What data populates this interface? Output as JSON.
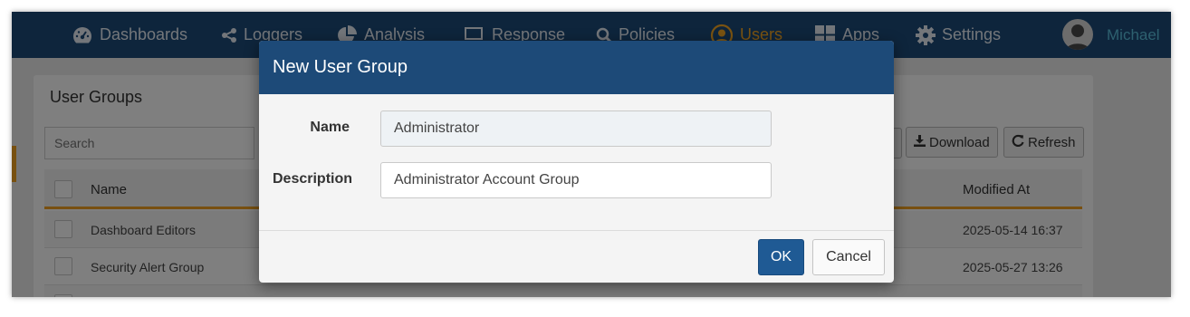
{
  "nav": {
    "items": [
      {
        "label": "Dashboards",
        "icon": "dashboard-gauge-icon"
      },
      {
        "label": "Loggers",
        "icon": "share-nodes-icon"
      },
      {
        "label": "Analysis",
        "icon": "pie-chart-icon"
      },
      {
        "label": "Response",
        "icon": "laptop-icon"
      },
      {
        "label": "Policies",
        "icon": "search-icon"
      },
      {
        "label": "Users",
        "icon": "user-circle-icon",
        "active": true
      },
      {
        "label": "Apps",
        "icon": "grid-icon"
      },
      {
        "label": "Settings",
        "icon": "gear-icon"
      }
    ],
    "user_name": "Michael",
    "active_color": "#f5a623",
    "bar_color": "#1d4a78"
  },
  "page": {
    "title": "User Groups",
    "search_placeholder": "Search",
    "download_label": "Download",
    "refresh_label": "Refresh",
    "columns": {
      "name": "Name",
      "modified": "Modified At"
    },
    "rows": [
      {
        "name": "Dashboard Editors",
        "modified": "2025-05-14 16:37"
      },
      {
        "name": "Security Alert Group",
        "modified": "2025-05-27 13:26"
      }
    ]
  },
  "modal": {
    "title": "New User Group",
    "name_label": "Name",
    "name_value": "Administrator",
    "description_label": "Description",
    "description_value": "Administrator Account Group",
    "ok_label": "OK",
    "cancel_label": "Cancel"
  }
}
